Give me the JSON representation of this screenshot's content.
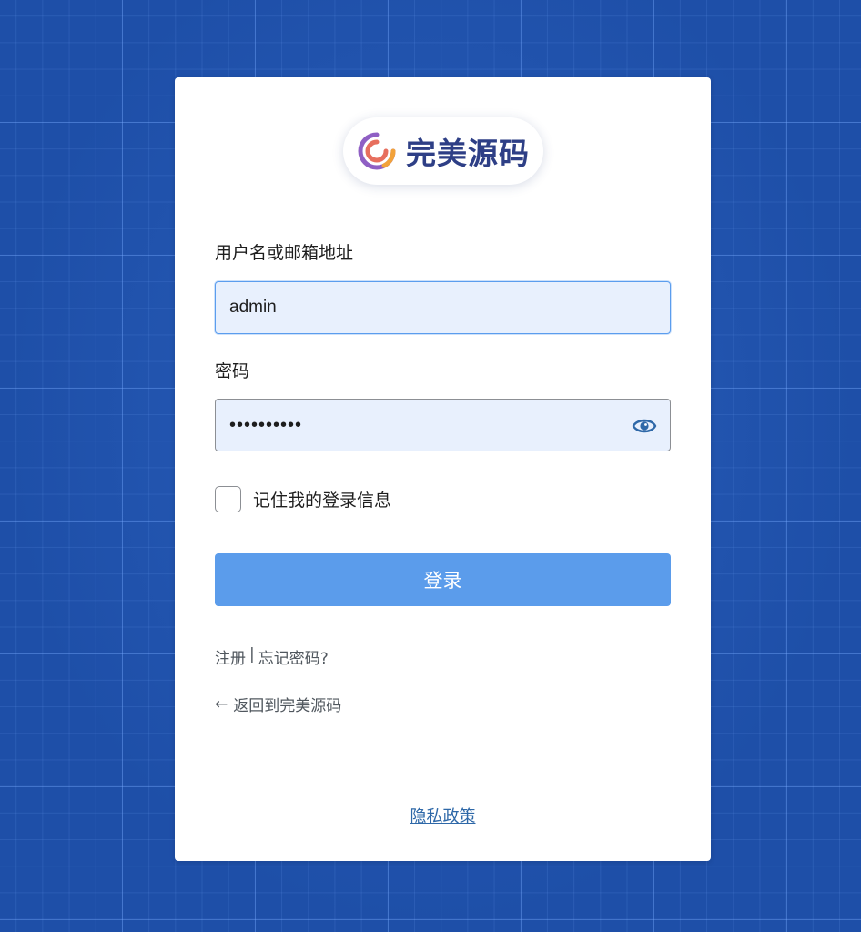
{
  "logo": {
    "text": "完美源码",
    "accent": "#2e3f86"
  },
  "form": {
    "username_label": "用户名或邮箱地址",
    "username_value": "admin",
    "password_label": "密码",
    "password_value": "••••••••••",
    "remember_label": "记住我的登录信息",
    "login_label": "登录"
  },
  "links": {
    "register": "注册",
    "separator": "|",
    "forgot": "忘记密码?",
    "back_arrow": "←",
    "back": "返回到完美源码",
    "privacy": "隐私政策"
  },
  "icons": {
    "password_toggle": "eye-icon",
    "back": "arrow-left-icon"
  },
  "colors": {
    "button": "#5b9ceb",
    "focus": "#5b9dee",
    "background": "#1e4fa8",
    "link": "#2e68a8"
  }
}
